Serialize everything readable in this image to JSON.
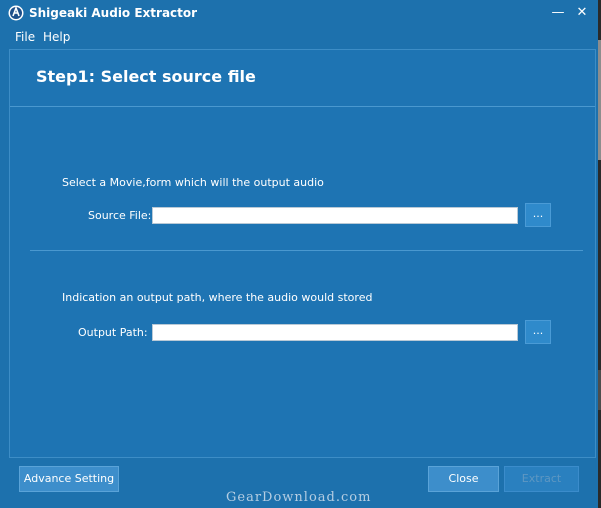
{
  "window": {
    "title": "Shigeaki Audio Extractor",
    "minimize_glyph": "—",
    "close_glyph": "✕",
    "icon": "audio-app-icon"
  },
  "menu": {
    "items": [
      "File",
      "Help"
    ]
  },
  "step": {
    "title": "Step1: Select source file"
  },
  "source": {
    "hint": "Select a Movie,form which will the output audio",
    "label": "Source File:",
    "value": "",
    "browse_label": "..."
  },
  "output": {
    "hint": "Indication an output path, where the audio would stored",
    "label": "Output Path:",
    "value": "",
    "browse_label": "..."
  },
  "footer": {
    "advance_label": "Advance Setting",
    "close_label": "Close",
    "extract_label": "Extract"
  },
  "watermark": "GearDownload.com",
  "colors": {
    "background": "#1d71ad",
    "panel": "#1e74b3",
    "button": "#3d8ecb",
    "disabled_text": "#5e97c2"
  }
}
